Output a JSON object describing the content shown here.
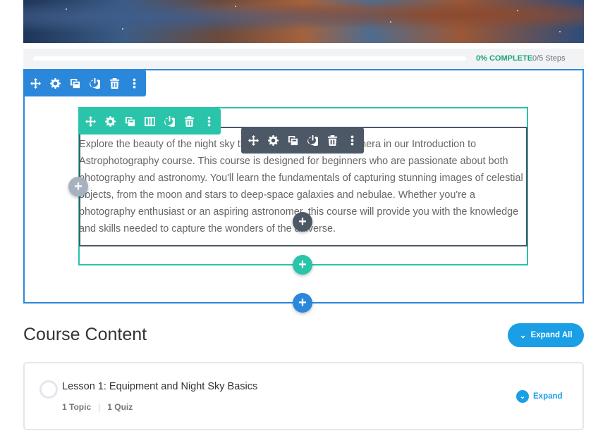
{
  "progress": {
    "percent": 0,
    "percent_label": "0% COMPLETE",
    "steps_label": "0/5 Steps"
  },
  "builder": {
    "section_toolbar_icons": [
      "move-icon",
      "gear-icon",
      "duplicate-icon",
      "power-icon",
      "trash-icon",
      "more-vertical-icon"
    ],
    "row_toolbar_icons": [
      "move-icon",
      "gear-icon",
      "duplicate-icon",
      "columns-icon",
      "power-icon",
      "trash-icon",
      "more-vertical-icon"
    ],
    "module_toolbar_icons": [
      "move-icon",
      "gear-icon",
      "duplicate-icon",
      "power-icon",
      "trash-icon",
      "more-vertical-icon"
    ],
    "add_symbol": "+",
    "colors": {
      "section": "#2b87da",
      "row": "#29c4a9",
      "module": "#4c5866"
    }
  },
  "intro": {
    "text": "Explore the beauty of the night sky through the lens of your camera in our Introduction to Astrophotography course. This course is designed for beginners who are passionate about both photography and astronomy. You'll learn the fundamentals of capturing stunning images of celestial objects, from the moon and stars to deep-space galaxies and nebulae. Whether you're a photography enthusiast or an aspiring astronomer, this course will provide you with the knowledge and skills needed to capture the wonders of the universe."
  },
  "course": {
    "heading": "Course Content",
    "expand_all_label": "Expand All",
    "lessons": [
      {
        "title": "Lesson 1: Equipment and Night Sky Basics",
        "topics": "1 Topic",
        "quizzes": "1 Quiz",
        "expand_label": "Expand"
      }
    ]
  }
}
